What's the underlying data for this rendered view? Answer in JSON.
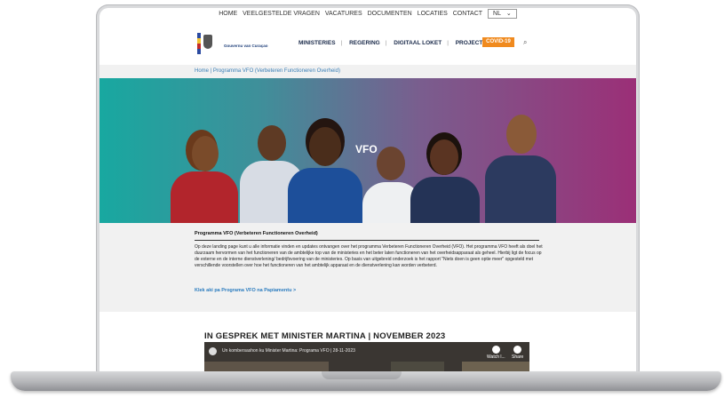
{
  "topnav": {
    "items": [
      "HOME",
      "VEELGESTELDE VRAGEN",
      "VACATURES",
      "DOCUMENTEN",
      "LOCATIES",
      "CONTACT"
    ],
    "language": "NL"
  },
  "header": {
    "government_name": "Gouvernu van Curaçao",
    "nav": [
      "MINISTERIES",
      "REGERING",
      "DIGITAAL LOKET",
      "PROJECTEN"
    ],
    "covid_label": "COVID-19",
    "search_icon": "search-icon"
  },
  "breadcrumb": "Home | Programma VFO (Verbeteren Functioneren Overheid)",
  "hero": {
    "label": "VFO"
  },
  "content": {
    "title": "Programma VFO (Verbeteren Functioneren Overheid)",
    "paragraph": "Op deze landing page kunt u alle informatie vinden en updates ontvangen over het programma Verbeteren Functioneren Overheid (VFO). Het programma VFO heeft als doel het duurzaam hervormen van het functioneren van de ambtelijke top van de ministeries en het beter laten functioneren van het overheidsapparaat als geheel. Hierbij ligt de focus op de externe en de interne dienstverlening/ bedrijfsvoering van de ministeries. Op basis van uitgebreid onderzoek is het rapport \"Niets doen is geen optie meer\" opgesteld met verschillende voorstellen over hoe het functioneren van het ambtelijk apparaat en de dienstverlening kan worden verbeterd.",
    "link": "Klek aki pa Programa VFO na Papiamentu >"
  },
  "interview": {
    "title": "IN GESPREK MET MINISTER MARTINA | NOVEMBER 2023",
    "video_title": "Un kombersashon ku Minister Martina: Programa VFO | 28-11-2023",
    "watch_later": "Watch l...",
    "share": "Share"
  }
}
